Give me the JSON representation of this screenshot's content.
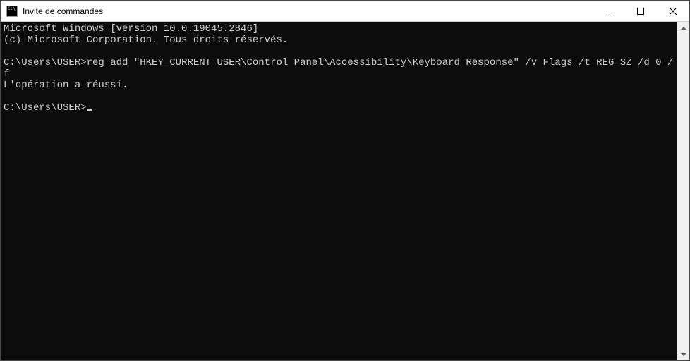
{
  "window": {
    "title": "Invite de commandes"
  },
  "terminal": {
    "line1": "Microsoft Windows [version 10.0.19045.2846]",
    "line2": "(c) Microsoft Corporation. Tous droits réservés.",
    "blank1": "",
    "prompt1": "C:\\Users\\USER>",
    "cmd1": "reg add \"HKEY_CURRENT_USER\\Control Panel\\Accessibility\\Keyboard Response\" /v Flags /t REG_SZ /d 0 /f",
    "result1": "L'opération a réussi.",
    "blank2": "",
    "prompt2": "C:\\Users\\USER>"
  },
  "colors": {
    "terminal_bg": "#0c0c0c",
    "terminal_fg": "#cccccc",
    "titlebar_bg": "#ffffff"
  }
}
